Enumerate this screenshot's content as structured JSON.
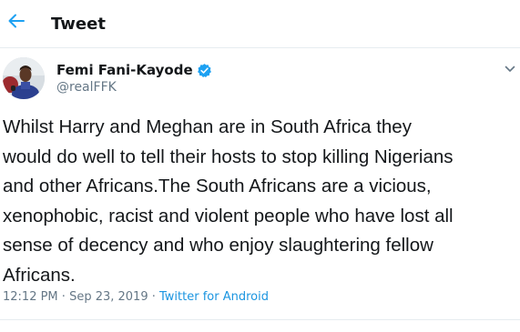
{
  "header": {
    "title": "Tweet",
    "back_icon": "arrow-left-icon"
  },
  "author": {
    "display_name": "Femi Fani-Kayode",
    "handle": "@realFFK",
    "verified_icon": "verified-badge-icon"
  },
  "tweet": {
    "text": "Whilst Harry and Meghan are in South Africa they\nwould do well to tell their hosts to stop killing Nigerians\nand other Africans.The South Africans are a vicious,\nxenophobic, racist and violent people who have lost all\nsense of decency and who enjoy slaughtering fellow\nAfricans.",
    "time": "12:12 PM",
    "separator1": " · ",
    "date": "Sep 23, 2019",
    "separator2": " · ",
    "source": "Twitter for Android"
  },
  "menu_icon": "chevron-down-icon",
  "colors": {
    "accent": "#1da1f2",
    "link": "#1b95e0",
    "muted": "#657786",
    "text": "#14171a"
  }
}
